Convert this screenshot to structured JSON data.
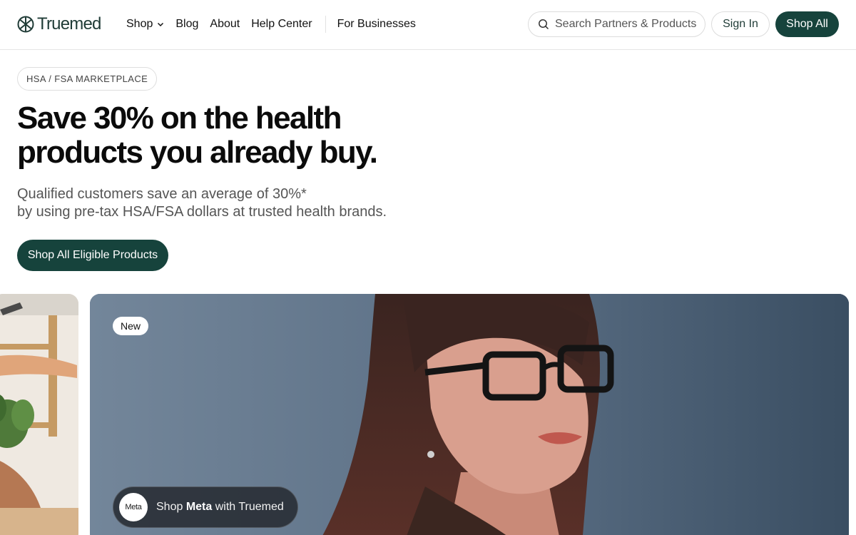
{
  "header": {
    "logo_text": "Truemed",
    "nav": [
      {
        "label": "Shop",
        "has_dropdown": true
      },
      {
        "label": "Blog"
      },
      {
        "label": "About"
      },
      {
        "label": "Help Center"
      }
    ],
    "nav_secondary": "For Businesses",
    "search_placeholder": "Search Partners & Products",
    "sign_in_label": "Sign In",
    "shop_all_label": "Shop All"
  },
  "hero": {
    "tag": "HSA / FSA MARKETPLACE",
    "headline_line1": "Save 30% on the health",
    "headline_line2": "products you already buy.",
    "subcopy_line1": "Qualified customers save an average of 30%*",
    "subcopy_line2": "by using pre-tax HSA/FSA dollars at trusted health brands.",
    "cta_label": "Shop All Eligible Products"
  },
  "featured_card": {
    "badge": "New",
    "chip_logo_text": "Meta",
    "chip_prefix": "Shop ",
    "chip_brand": "Meta",
    "chip_suffix": " with Truemed"
  },
  "icons": {
    "logo": "truemed-logo-icon",
    "search": "search-icon",
    "dropdown": "chevron-down-icon",
    "meta": "meta-logo-icon"
  },
  "colors": {
    "brand_dark_green": "#16433c",
    "logo_green": "#1f3b36",
    "card_backdrop": "#5b6e84"
  }
}
